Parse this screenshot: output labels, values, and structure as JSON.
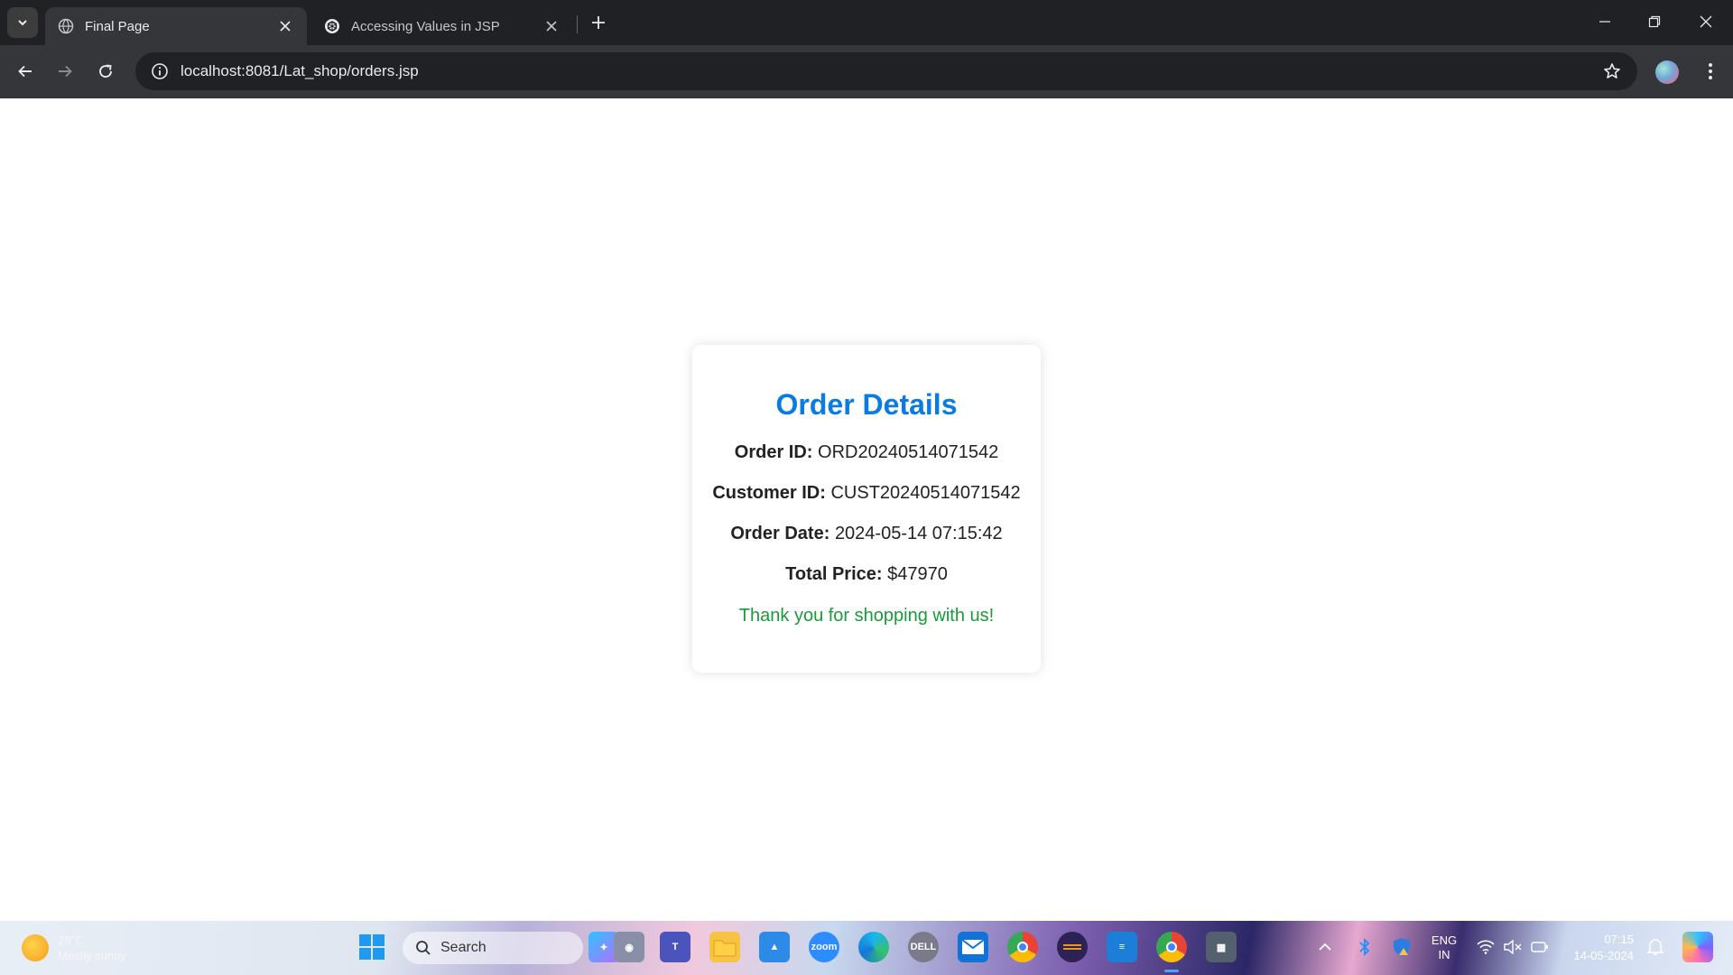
{
  "browser": {
    "tabs": [
      {
        "title": "Final Page",
        "active": true
      },
      {
        "title": "Accessing Values in JSP",
        "active": false
      }
    ],
    "url": "localhost:8081/Lat_shop/orders.jsp"
  },
  "page": {
    "heading": "Order Details",
    "fields": [
      {
        "label": "Order ID:",
        "value": "ORD20240514071542"
      },
      {
        "label": "Customer ID:",
        "value": "CUST20240514071542"
      },
      {
        "label": "Order Date:",
        "value": "2024-05-14 07:15:42"
      },
      {
        "label": "Total Price:",
        "value": "$47970"
      }
    ],
    "thanks": "Thank you for shopping with us!",
    "colors": {
      "heading": "#0a7be0",
      "thanks": "#1a9a3a"
    }
  },
  "taskbar": {
    "weather": {
      "temp": "28°C",
      "condition": "Mostly sunny"
    },
    "search_label": "Search",
    "language": {
      "line1": "ENG",
      "line2": "IN"
    },
    "clock": {
      "time": "07:15",
      "date": "14-05-2024"
    },
    "apps": [
      "windows-start",
      "search",
      "copilot",
      "chat",
      "teams",
      "file-explorer",
      "photos",
      "zoom",
      "edge",
      "dell",
      "mail",
      "chrome",
      "eclipse",
      "notepad",
      "chrome-active",
      "calculator"
    ]
  }
}
